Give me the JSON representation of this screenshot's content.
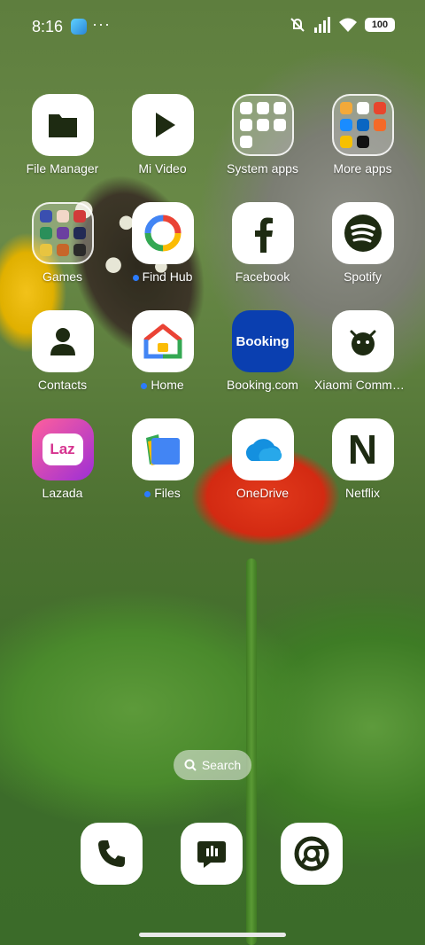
{
  "status_bar": {
    "time": "8:16",
    "more": "···",
    "battery": "100"
  },
  "apps": [
    {
      "label": "File Manager",
      "icon": "folder-icon"
    },
    {
      "label": "Mi Video",
      "icon": "play-icon"
    },
    {
      "label": "System apps",
      "icon": "folder-system-apps"
    },
    {
      "label": "More apps",
      "icon": "folder-more-apps"
    },
    {
      "label": "Games",
      "icon": "folder-games"
    },
    {
      "label": "Find Hub",
      "icon": "find-hub-icon"
    },
    {
      "label": "Facebook",
      "icon": "facebook-icon"
    },
    {
      "label": "Spotify",
      "icon": "spotify-icon"
    },
    {
      "label": "Contacts",
      "icon": "contact-icon"
    },
    {
      "label": "Home",
      "icon": "google-home-icon"
    },
    {
      "label": "Booking.com",
      "icon": "booking-icon",
      "icon_text": "Booking"
    },
    {
      "label": "Xiaomi Commu…",
      "icon": "xiaomi-community-icon"
    },
    {
      "label": "Lazada",
      "icon": "lazada-icon",
      "icon_text": "Laz"
    },
    {
      "label": "Files",
      "icon": "google-files-icon"
    },
    {
      "label": "OneDrive",
      "icon": "onedrive-icon"
    },
    {
      "label": "Netflix",
      "icon": "netflix-icon",
      "icon_text": "N"
    }
  ],
  "search": {
    "label": "Search"
  },
  "dock": [
    {
      "icon": "phone-icon"
    },
    {
      "icon": "messages-icon"
    },
    {
      "icon": "chrome-icon"
    }
  ],
  "colors": {
    "icon_dark": "#1e2b12",
    "booking_blue": "#0a3fb0",
    "lazada_pink": "#d6338f",
    "dot_blue": "#2b7bff"
  }
}
